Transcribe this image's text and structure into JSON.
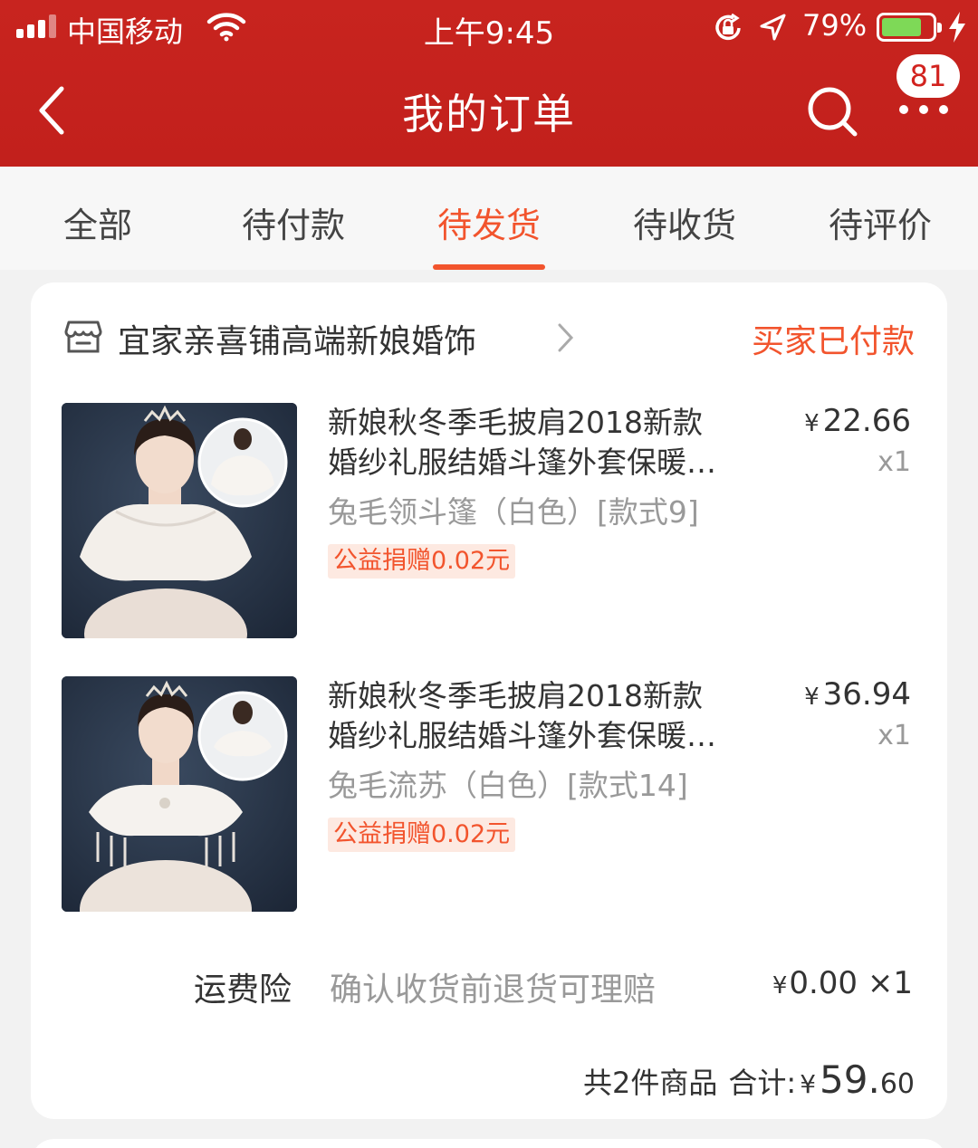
{
  "status_bar": {
    "carrier": "中国移动",
    "time": "上午9:45",
    "battery_percent": "79%",
    "battery_level": 0.79,
    "signal_bars": 3,
    "icons": [
      "signal-icon",
      "wifi-icon",
      "orientation-lock-icon",
      "location-arrow-icon",
      "battery-icon",
      "charging-bolt-icon"
    ]
  },
  "nav": {
    "title": "我的订单",
    "badge": "81",
    "icons": [
      "back-chevron-icon",
      "search-icon",
      "more-dots-icon"
    ]
  },
  "tabs": [
    {
      "label": "全部",
      "active": false
    },
    {
      "label": "待付款",
      "active": false
    },
    {
      "label": "待发货",
      "active": true
    },
    {
      "label": "待收货",
      "active": false
    },
    {
      "label": "待评价",
      "active": false
    }
  ],
  "order": {
    "shop_name": "宜家亲喜铺高端新娘婚饰",
    "status": "买家已付款",
    "items": [
      {
        "title_line1": "新娘秋冬季毛披肩2018新款",
        "title_line2": "婚纱礼服结婚斗篷外套保暖…",
        "sku": "兔毛领斗篷（白色）[款式9]",
        "tag": "公益捐赠0.02元",
        "currency": "¥",
        "price": "22.66",
        "qty": "x1"
      },
      {
        "title_line1": "新娘秋冬季毛披肩2018新款",
        "title_line2": "婚纱礼服结婚斗篷外套保暖…",
        "sku": "兔毛流苏（白色）[款式14]",
        "tag": "公益捐赠0.02元",
        "currency": "¥",
        "price": "36.94",
        "qty": "x1"
      }
    ],
    "insurance": {
      "label": "运费险",
      "desc": "确认收货前退货可理赔",
      "currency": "¥",
      "price": "0.00",
      "qty": "×1"
    },
    "summary": {
      "count_text": "共2件商品",
      "total_label": "合计:",
      "currency": "¥",
      "total_int": "59.",
      "total_dec": "60"
    }
  },
  "colors": {
    "header_red": "#c2201c",
    "accent_orange": "#f2542d",
    "tag_bg": "#fde9e1",
    "battery_green": "#7ed957"
  }
}
